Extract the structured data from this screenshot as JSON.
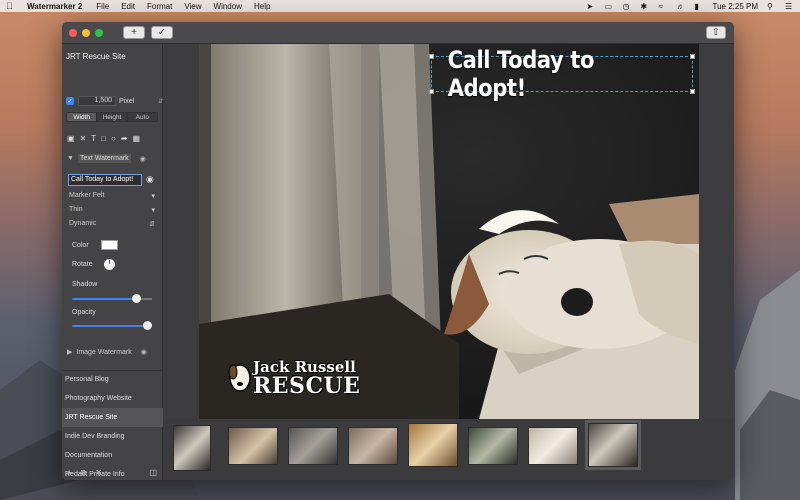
{
  "menubar": {
    "app_name": "Watermarker 2",
    "menus": [
      "File",
      "Edit",
      "Format",
      "View",
      "Window",
      "Help"
    ],
    "clock": "Tue 2:25 PM"
  },
  "toolbar": {
    "add_label": "+",
    "confirm_icon": "checkmark-icon",
    "share_icon": "share-icon"
  },
  "sidebar": {
    "site_title": "JRT Rescue Site",
    "size": {
      "value": "1,500",
      "unit": "Pixel"
    },
    "dimension_options": [
      "Width",
      "Height",
      "Auto"
    ],
    "dimension_selected": "Width",
    "text_watermark": {
      "section_label": "Text Watermark",
      "text": "Call Today to Adopt!",
      "font": "Marker Felt",
      "weight": "Thin",
      "mode": "Dynamic",
      "color_label": "Color",
      "color_value": "#ffffff",
      "rotate_label": "Rotate",
      "shadow_label": "Shadow",
      "shadow_level": 0.85,
      "opacity_label": "Opacity",
      "opacity_level": 1.0
    },
    "image_watermark_label": "Image Watermark",
    "sites": [
      "Personal Blog",
      "Photography Website",
      "JRT Rescue Site",
      "Indie Dev Branding",
      "Documentation",
      "Redact Private Info"
    ],
    "selected_site": "JRT Rescue Site"
  },
  "photo": {
    "watermark_text": "Call Today to Adopt!",
    "logo_line1": "Jack Russell",
    "logo_line2": "RESCUE"
  },
  "thumbnails": {
    "count": 8,
    "selected_index": 7
  }
}
